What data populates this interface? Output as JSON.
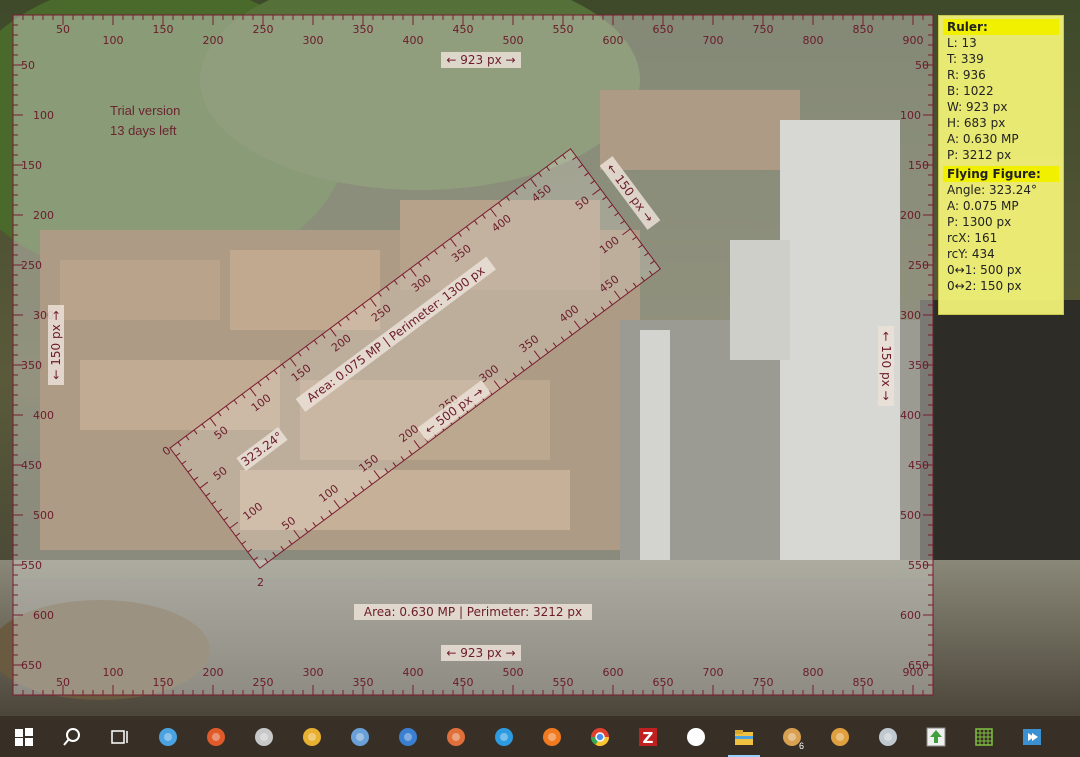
{
  "trial": {
    "line1": "Trial version",
    "line2": "13 days left"
  },
  "ruler": {
    "top_dimension": "← 923 px →",
    "bottom_dimension": "← 923 px →",
    "area_perimeter": "Area: 0.630 MP  | Perimeter: 3212 px",
    "h_ticks": [
      "50",
      "100",
      "150",
      "200",
      "250",
      "300",
      "350",
      "400",
      "450",
      "500",
      "550",
      "600",
      "650",
      "700",
      "750",
      "800",
      "850",
      "900"
    ],
    "v_ticks": [
      "50",
      "100",
      "150",
      "200",
      "250",
      "300",
      "350",
      "400",
      "450",
      "500",
      "550",
      "600",
      "650"
    ]
  },
  "flying": {
    "angle_label": "323.24°",
    "area_perimeter": "Area: 0.075 MP  | Perimeter: 1300 px",
    "length_label": "← 500 px →",
    "width_label": "← 150 px →",
    "left_side_label": "← 150 px →",
    "right_side_label": "← 150 px →",
    "top_edge_ticks": [
      "50",
      "100",
      "150",
      "200",
      "250",
      "300",
      "350",
      "400",
      "450"
    ],
    "bottom_edge_ticks": [
      "50",
      "100",
      "150",
      "200",
      "250",
      "300",
      "350",
      "400",
      "450"
    ],
    "left_edge_ticks": [
      "50",
      "100"
    ],
    "right_edge_ticks": [
      "50",
      "100"
    ],
    "corner0": "0",
    "corner2": "2"
  },
  "info": {
    "ruler_header": "Ruler:",
    "ruler_rows": [
      "L: 13",
      "T: 339",
      "R: 936",
      "B: 1022",
      "W: 923 px",
      "H: 683 px",
      "A: 0.630 MP",
      "P: 3212 px"
    ],
    "flying_header": "Flying Figure:",
    "flying_rows": [
      "Angle: 323.24°",
      "A: 0.075 MP",
      "P: 1300 px",
      "rcX: 161",
      "rcY: 434",
      "0↔1: 500 px",
      "0↔2: 150 px"
    ]
  },
  "taskbar": {
    "items": [
      {
        "name": "start-icon",
        "color": "#ffffff"
      },
      {
        "name": "search-icon",
        "color": "#ffffff"
      },
      {
        "name": "task-view-icon",
        "color": "#ffffff"
      },
      {
        "name": "control-panel-icon",
        "color": "#4aa3e0"
      },
      {
        "name": "ccleaner-icon",
        "color": "#e05a2a"
      },
      {
        "name": "scanner-icon",
        "color": "#c8c8c8"
      },
      {
        "name": "broom-icon",
        "color": "#e8b030"
      },
      {
        "name": "app-blue-icon",
        "color": "#6aa0d8"
      },
      {
        "name": "malwarebytes-icon",
        "color": "#3a7fd0"
      },
      {
        "name": "app-orange-icon",
        "color": "#e0703a"
      },
      {
        "name": "edge-icon",
        "color": "#2d9be0"
      },
      {
        "name": "firefox-icon",
        "color": "#f07a20"
      },
      {
        "name": "chrome-icon",
        "color": "#e04030"
      },
      {
        "name": "filezilla-icon",
        "color": "#c02020"
      },
      {
        "name": "inkscape-icon",
        "color": "#ffffff"
      },
      {
        "name": "file-explorer-icon",
        "color": "#f0c040"
      },
      {
        "name": "palette-icon",
        "color": "#d8a050"
      },
      {
        "name": "media-player-icon",
        "color": "#e0a040"
      },
      {
        "name": "notepad-icon",
        "color": "#c0c8d0"
      },
      {
        "name": "upload-icon",
        "color": "#40a040"
      },
      {
        "name": "grid-app-icon",
        "color": "#80c040"
      },
      {
        "name": "remote-icon",
        "color": "#3a90d0"
      }
    ],
    "palette_badge": "6"
  }
}
